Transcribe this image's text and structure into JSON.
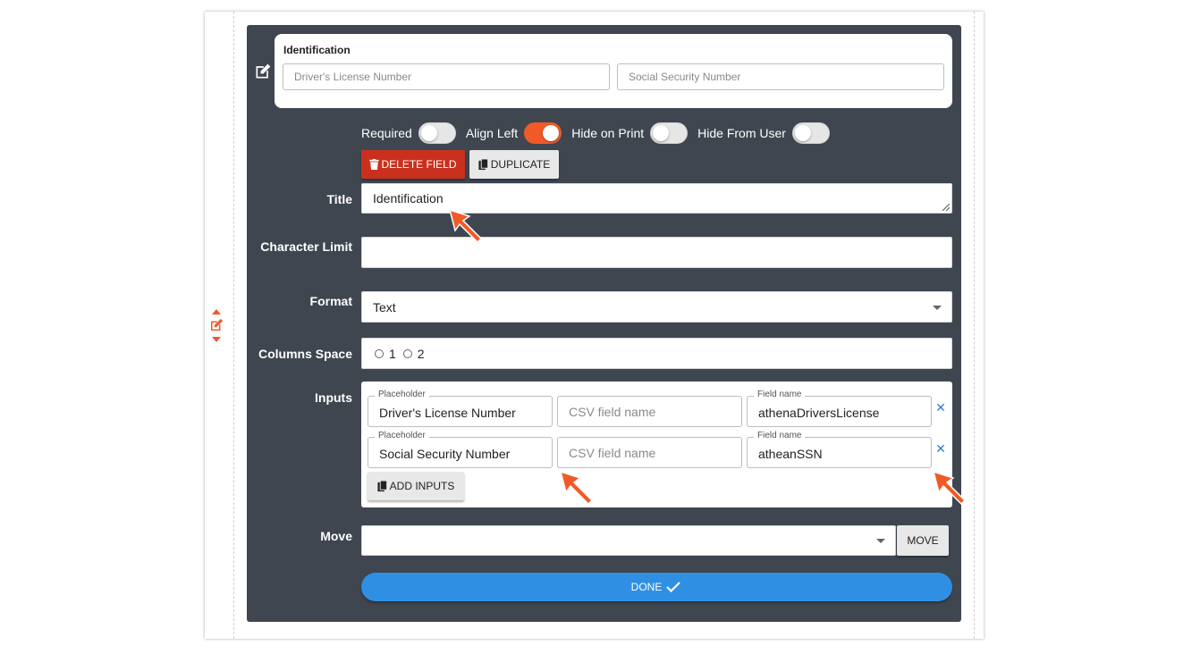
{
  "preview": {
    "title": "Identification",
    "inputs": [
      "Driver's License Number",
      "Social Security Number"
    ]
  },
  "toggles": [
    {
      "label": "Required",
      "on": false
    },
    {
      "label": "Align Left",
      "on": true
    },
    {
      "label": "Hide on Print",
      "on": false
    },
    {
      "label": "Hide From User",
      "on": false
    }
  ],
  "buttons": {
    "delete": "DELETE FIELD",
    "duplicate": "DUPLICATE",
    "add_inputs": "ADD INPUTS",
    "move": "MOVE",
    "done": "DONE"
  },
  "labels": {
    "title": "Title",
    "character_limit": "Character Limit",
    "format": "Format",
    "columns_space": "Columns Space",
    "inputs": "Inputs",
    "move": "Move"
  },
  "fields": {
    "title_value": "Identification",
    "character_limit_value": "",
    "format_value": "Text",
    "columns_options": [
      "1",
      "2"
    ]
  },
  "inputs_rows": [
    {
      "placeholder_label": "Placeholder",
      "placeholder": "Driver's License Number",
      "csv_placeholder": "CSV field name",
      "field_name_label": "Field name",
      "field_name": "athenaDriversLicense"
    },
    {
      "placeholder_label": "Placeholder",
      "placeholder": "Social Security Number",
      "csv_placeholder": "CSV field name",
      "field_name_label": "Field name",
      "field_name": "atheanSSN"
    }
  ],
  "colors": {
    "accent": "#f05a28",
    "panel": "#3f4650",
    "delete": "#c9311e",
    "done": "#2f8fe3",
    "remove_icon": "#2e7dd4"
  },
  "icons": [
    "edit-icon",
    "trash-icon",
    "copy-icon",
    "check-icon",
    "remove-icon",
    "chevron-down-icon",
    "move-up-icon",
    "move-down-icon"
  ]
}
